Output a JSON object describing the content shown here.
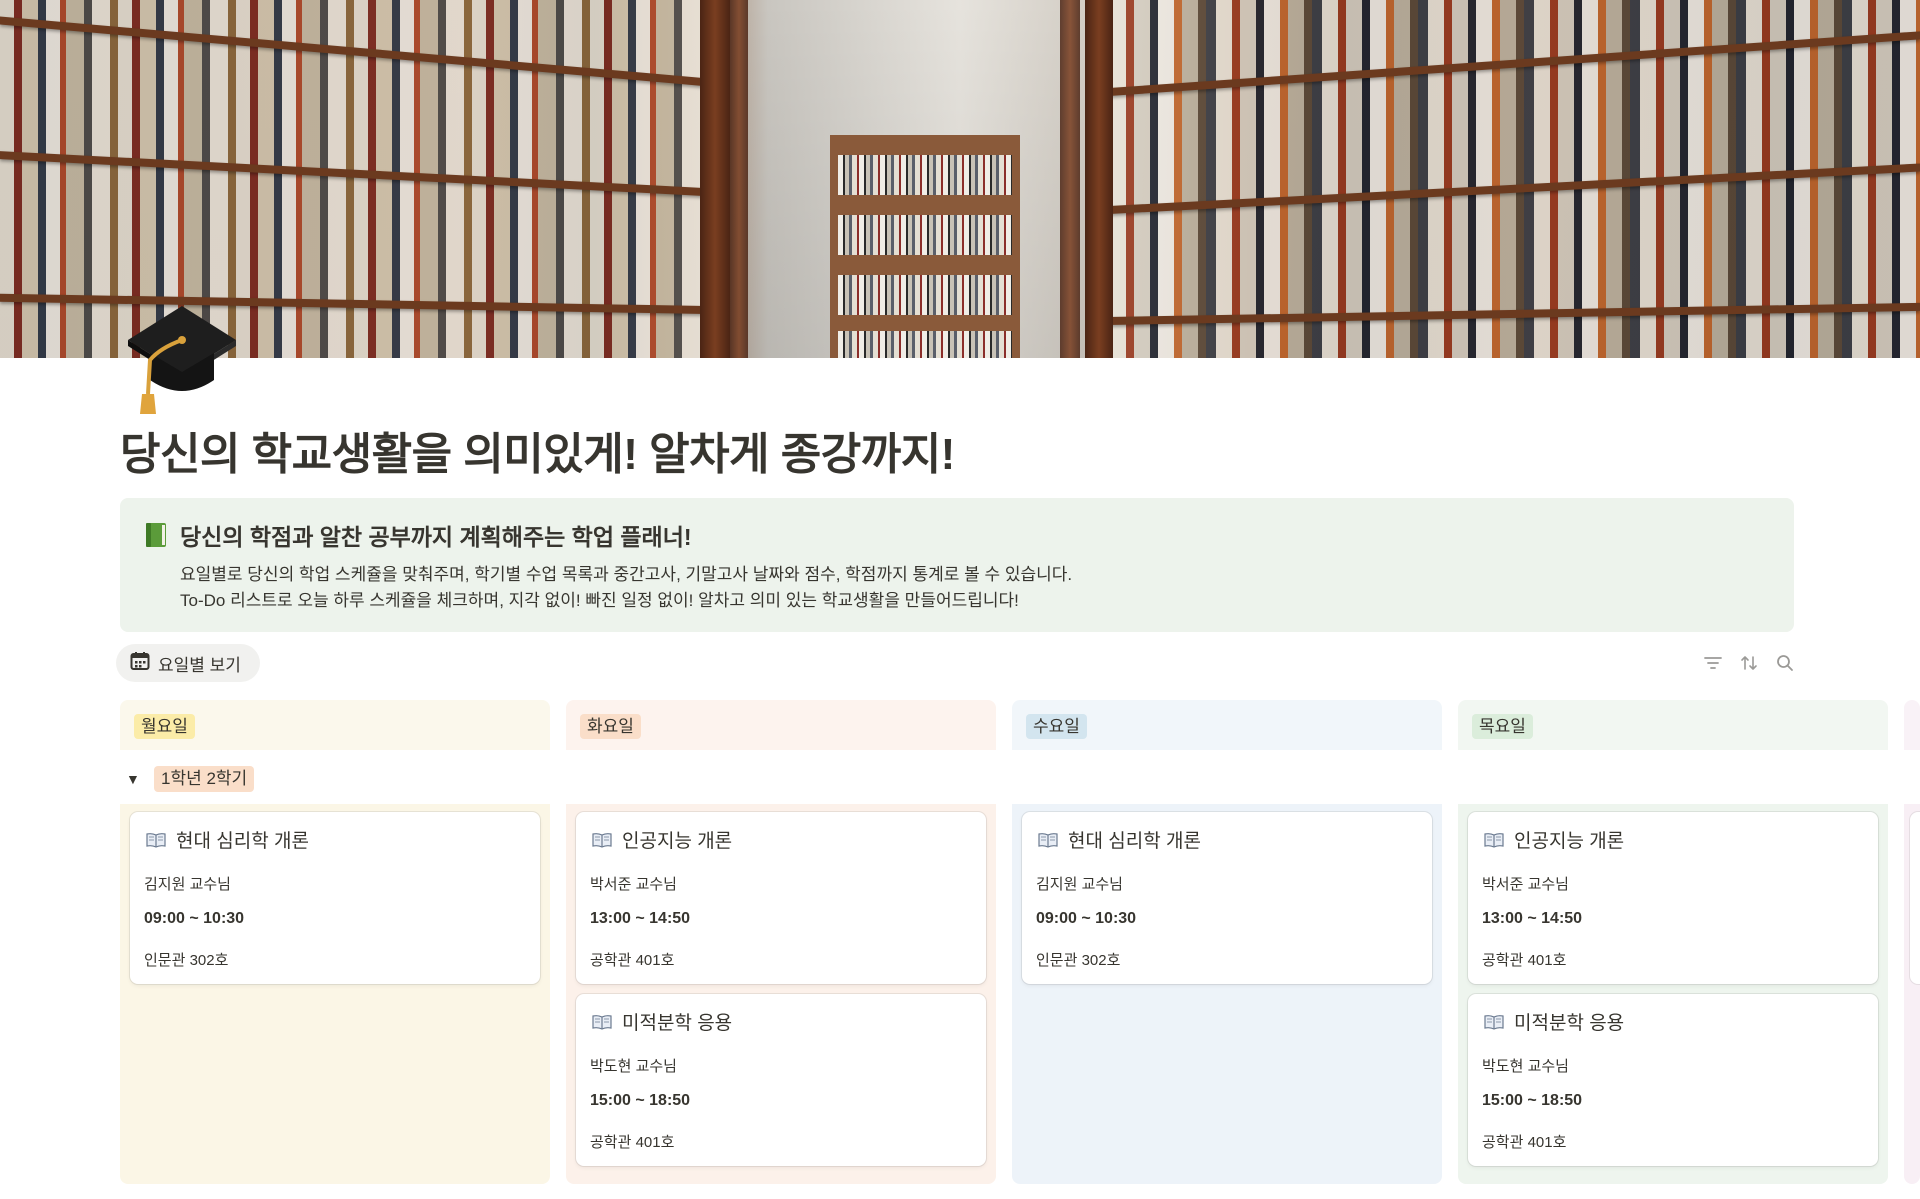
{
  "page": {
    "title": "당신의 학교생활을 의미있게! 알차게 종강까지!",
    "icon": "graduation-cap-icon",
    "cover": "library-bookshelves-photo"
  },
  "callout": {
    "icon": "green-book-icon",
    "title": "당신의 학점과 알찬 공부까지 계획해주는 학업 플래너!",
    "line1": "요일별로 당신의 학업 스케쥴을 맞춰주며, 학기별 수업 목록과 중간고사, 기말고사 날짜와 점수, 학점까지 통계로 볼 수 있습니다.",
    "line2": "To-Do 리스트로 오늘 하루 스케쥴을 체크하며, 지각 없이! 빠진 일정 없이! 알차고 의미 있는 학교생활을 만들어드립니다!"
  },
  "view": {
    "tab_icon": "calendar-icon",
    "tab_label": "요일별 보기",
    "tools": [
      "filter-icon",
      "sort-icon",
      "search-icon"
    ]
  },
  "group": {
    "label": "1학년 2학기",
    "expanded": true
  },
  "columns": [
    {
      "day": "월요일",
      "head_bg": "#fbf8ec",
      "body_bg": "#fbf6e6",
      "tag_bg": "#fbeca8",
      "cards": [
        {
          "title": "현대 심리학 개론",
          "professor": "김지원 교수님",
          "time": "09:00 ~ 10:30",
          "room": "인문관 302호"
        }
      ]
    },
    {
      "day": "화요일",
      "head_bg": "#fdf3ee",
      "body_bg": "#fcf1ea",
      "tag_bg": "#fadec9",
      "cards": [
        {
          "title": "인공지능 개론",
          "professor": "박서준 교수님",
          "time": "13:00 ~ 14:50",
          "room": "공학관 401호"
        },
        {
          "title": "미적분학 응용",
          "professor": "박도현 교수님",
          "time": "15:00 ~ 18:50",
          "room": "공학관 401호"
        }
      ]
    },
    {
      "day": "수요일",
      "head_bg": "#f1f6fa",
      "body_bg": "#edf3f9",
      "tag_bg": "#d3e5ef",
      "cards": [
        {
          "title": "현대 심리학 개론",
          "professor": "김지원 교수님",
          "time": "09:00 ~ 10:30",
          "room": "인문관 302호"
        }
      ]
    },
    {
      "day": "목요일",
      "head_bg": "#f2f7f2",
      "body_bg": "#eef5ee",
      "tag_bg": "#dbeddb",
      "cards": [
        {
          "title": "인공지능 개론",
          "professor": "박서준 교수님",
          "time": "13:00 ~ 14:50",
          "room": "공학관 401호"
        },
        {
          "title": "미적분학 응용",
          "professor": "박도현 교수님",
          "time": "15:00 ~ 18:50",
          "room": "공학관 401호"
        }
      ]
    }
  ]
}
